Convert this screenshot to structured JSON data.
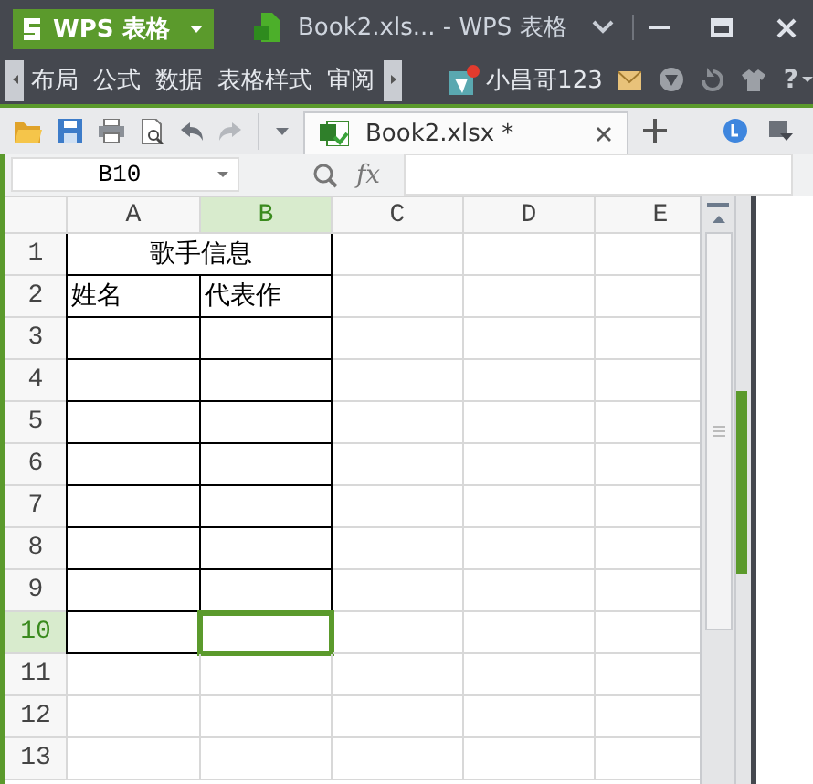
{
  "app_menu": {
    "label": "WPS 表格"
  },
  "window": {
    "title": "Book2.xls... - WPS 表格"
  },
  "ribbon_tabs": [
    {
      "label": "布局",
      "selected": false
    },
    {
      "label": "公式",
      "selected": false
    },
    {
      "label": "数据",
      "selected": false
    },
    {
      "label": "表格样式",
      "selected": false
    },
    {
      "label": "审阅",
      "selected": false
    }
  ],
  "user": {
    "name": "小昌哥123",
    "notification": true
  },
  "help": "?",
  "document_tabs": [
    {
      "label": "Book2.xlsx *",
      "selected": true
    }
  ],
  "name_box": {
    "value": "B10"
  },
  "formula_bar": {
    "fx_label": "fx"
  },
  "sheet": {
    "columns": [
      {
        "label": "A",
        "selected": false
      },
      {
        "label": "B",
        "selected": true
      },
      {
        "label": "C",
        "selected": false
      },
      {
        "label": "D",
        "selected": false
      },
      {
        "label": "E",
        "selected": false
      }
    ],
    "rows": [
      {
        "header": "1",
        "selected": false,
        "bordered": true,
        "merged_title": "歌手信息"
      },
      {
        "header": "2",
        "selected": false,
        "bordered": true,
        "cells": [
          "姓名",
          "代表作"
        ]
      },
      {
        "header": "3",
        "selected": false,
        "bordered": true
      },
      {
        "header": "4",
        "selected": false,
        "bordered": true
      },
      {
        "header": "5",
        "selected": false,
        "bordered": true
      },
      {
        "header": "6",
        "selected": false,
        "bordered": true
      },
      {
        "header": "7",
        "selected": false,
        "bordered": true
      },
      {
        "header": "8",
        "selected": false,
        "bordered": true
      },
      {
        "header": "9",
        "selected": false,
        "bordered": true
      },
      {
        "header": "10",
        "selected": true,
        "bordered": true
      },
      {
        "header": "11",
        "selected": false,
        "bordered": false
      },
      {
        "header": "12",
        "selected": false,
        "bordered": false
      },
      {
        "header": "13",
        "selected": false,
        "bordered": false
      }
    ]
  }
}
